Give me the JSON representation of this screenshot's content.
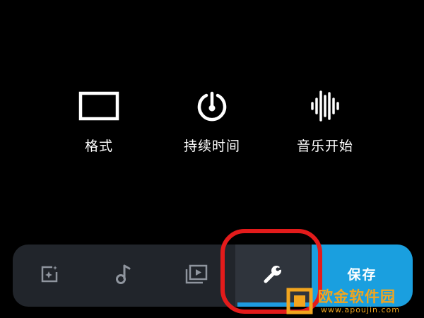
{
  "options": [
    {
      "label": "格式",
      "icon": "rectangle-format-icon"
    },
    {
      "label": "持续时间",
      "icon": "timer-dial-icon"
    },
    {
      "label": "音乐开始",
      "icon": "audio-waveform-icon"
    }
  ],
  "toolbar": {
    "tools": [
      {
        "name": "effects",
        "icon": "sparkle-frame-icon",
        "active": false
      },
      {
        "name": "music",
        "icon": "music-note-icon",
        "active": false
      },
      {
        "name": "media",
        "icon": "play-frame-icon",
        "active": false
      },
      {
        "name": "settings",
        "icon": "wrench-icon",
        "active": true
      }
    ],
    "save_label": "保存"
  },
  "watermark": {
    "text": "欧金软件园",
    "url": "www.apoujin.com"
  },
  "colors": {
    "background": "#000000",
    "toolbar": "#21252b",
    "active_tool": "#2f343c",
    "accent": "#1a9fdf",
    "highlight": "#e31b1b",
    "watermark": "#f2a51e"
  }
}
